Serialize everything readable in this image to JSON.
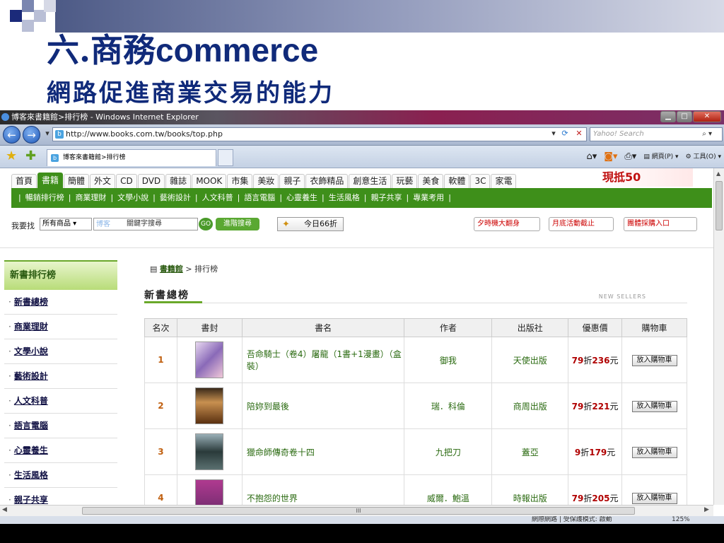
{
  "slide": {
    "title_zh": "六.商務",
    "title_en": "commerce",
    "subtitle": "網路促進商業交易的能力"
  },
  "browser": {
    "window_title": "博客來書籍館>排行榜 - Windows Internet Explorer",
    "address": "http://www.books.com.tw/books/top.php",
    "search_placeholder": "Yahoo! Search",
    "tab_title": "博客來書籍館>排行榜",
    "cmd_page": "網頁(P)",
    "cmd_tools": "工具(O)",
    "status_text": "網際網路 | 受保護模式: 啟動",
    "zoom": "125%",
    "scroll_marker": "III"
  },
  "site": {
    "categories": [
      "首頁",
      "書籍",
      "簡體",
      "外文",
      "CD",
      "DVD",
      "雜誌",
      "MOOK",
      "市集",
      "美妝",
      "親子",
      "衣飾精品",
      "創意生活",
      "玩藝",
      "美食",
      "軟體",
      "3C",
      "家電"
    ],
    "active_category": "書籍",
    "banner_text": "現抵50",
    "subnav": [
      "暢銷排行榜",
      "商業理財",
      "文學小說",
      "藝術設計",
      "人文科普",
      "語言電腦",
      "心靈養生",
      "生活風格",
      "親子共享",
      "專業考用"
    ],
    "search": {
      "label": "我要找",
      "scope": "所有商品",
      "logo": "博客",
      "placeholder": "關鍵字搜尋",
      "go": "GO",
      "advanced": "進階搜尋",
      "today": "今日66折",
      "promo1": "夕時機大翻身",
      "promo2": "月底活動截止",
      "promo3": "團體採購入口"
    }
  },
  "sidebar": {
    "heading": "新書排行榜",
    "items": [
      "新書總榜",
      "商業理財",
      "文學小說",
      "藝術設計",
      "人文科普",
      "語言電腦",
      "心靈養生",
      "生活風格",
      "親子共享"
    ]
  },
  "breadcrumb": {
    "link": "書籍館",
    "rest": " > 排行榜"
  },
  "section": {
    "title": "新書總榜",
    "en": "NEW SELLERS"
  },
  "table": {
    "headers": [
      "名次",
      "書封",
      "書名",
      "作者",
      "出版社",
      "優惠價",
      "購物車"
    ],
    "rows": [
      {
        "rank": "1",
        "title": "吾命騎士（卷4）屠龍（1書+1漫畫）（盒裝）",
        "author": "御我",
        "publisher": "天使出版",
        "disc": "79",
        "disc_unit": "折",
        "price": "236",
        "price_unit": "元",
        "cart": "放入購物車"
      },
      {
        "rank": "2",
        "title": "陪妳到最後",
        "author": "瑞．科倫",
        "publisher": "商周出版",
        "disc": "79",
        "disc_unit": "折",
        "price": "221",
        "price_unit": "元",
        "cart": "放入購物車"
      },
      {
        "rank": "3",
        "title": "獵命師傳奇卷十四",
        "author": "九把刀",
        "publisher": "蓋亞",
        "disc": "9",
        "disc_unit": "折",
        "price": "179",
        "price_unit": "元",
        "cart": "放入購物車"
      },
      {
        "rank": "4",
        "title": "不抱怨的世界",
        "author": "威爾．鮑溫",
        "publisher": "時報出版",
        "disc": "79",
        "disc_unit": "折",
        "price": "205",
        "price_unit": "元",
        "cart": "放入購物車"
      }
    ]
  },
  "colors": {
    "title": "#102a7a",
    "site_green": "#3e8f1a",
    "price_red": "#b00000"
  }
}
